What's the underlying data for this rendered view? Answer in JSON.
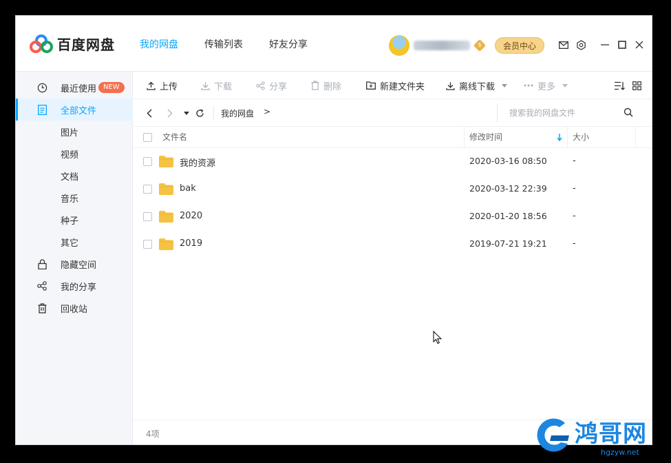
{
  "app": {
    "name": "百度网盘"
  },
  "nav": {
    "tabs": [
      {
        "label": "我的网盘"
      },
      {
        "label": "传输列表"
      },
      {
        "label": "好友分享"
      }
    ]
  },
  "account": {
    "vip_symbol": "$",
    "member_center": "会员中心"
  },
  "sidebar": {
    "items": [
      {
        "label": "最近使用",
        "badge": "NEW"
      },
      {
        "label": "全部文件"
      },
      {
        "label": "图片"
      },
      {
        "label": "视频"
      },
      {
        "label": "文档"
      },
      {
        "label": "音乐"
      },
      {
        "label": "种子"
      },
      {
        "label": "其它"
      },
      {
        "label": "隐藏空间"
      },
      {
        "label": "我的分享"
      },
      {
        "label": "回收站"
      }
    ]
  },
  "toolbar": {
    "upload": "上传",
    "download": "下载",
    "share": "分享",
    "delete": "删除",
    "new_folder": "新建文件夹",
    "offline_download": "离线下载",
    "more": "更多"
  },
  "path": {
    "crumbs": [
      "我的网盘"
    ],
    "separator": ">",
    "search_placeholder": "搜索我的网盘文件"
  },
  "table": {
    "columns": {
      "name": "文件名",
      "modified": "修改时间",
      "size": "大小"
    },
    "rows": [
      {
        "name": "我的资源",
        "modified": "2020-03-16 08:50",
        "size": "-"
      },
      {
        "name": "bak",
        "modified": "2020-03-12 22:39",
        "size": "-"
      },
      {
        "name": "2020",
        "modified": "2020-01-20 18:56",
        "size": "-"
      },
      {
        "name": "2019",
        "modified": "2019-07-21 19:21",
        "size": "-"
      }
    ]
  },
  "status": {
    "count": "4项"
  },
  "watermark": {
    "text": "鸿哥网",
    "url": "hgzyw.net"
  },
  "colors": {
    "accent": "#06a7ff",
    "folder": "#f5c242",
    "badge": "#f56f4f",
    "member": "#f7d48a"
  }
}
